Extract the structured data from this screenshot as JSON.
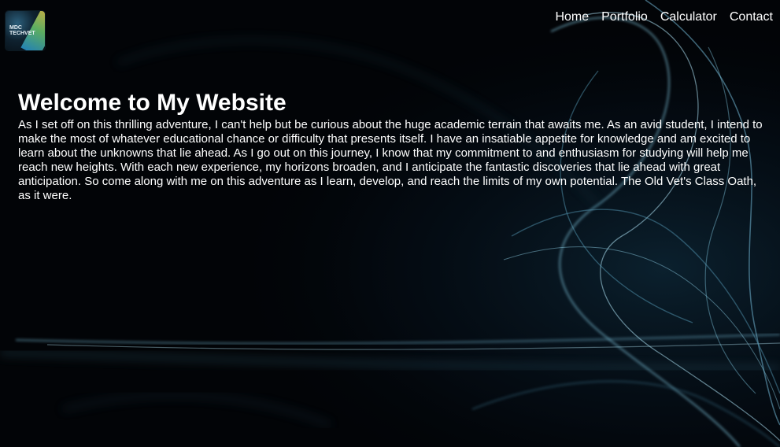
{
  "logo": {
    "line1": "MDC",
    "line2": "TECHVET"
  },
  "nav": {
    "items": [
      "Home",
      "Portfolio",
      "Calculator",
      "Contact"
    ]
  },
  "main": {
    "title": "Welcome to My Website",
    "body": "As I set off on this thrilling adventure, I can't help but be curious about the huge academic terrain that awaits me. As an avid student, I intend to make the most of whatever educational chance or difficulty that presents itself. I have an insatiable appetite for knowledge and am excited to learn about the unknowns that lie ahead. As I go out on this journey, I know that my commitment to and enthusiasm for studying will help me reach new heights. With each new experience, my horizons broaden, and I anticipate the fantastic discoveries that lie ahead with great anticipation. So come along with me on this adventure as I learn, develop, and reach the limits of my own potential. The Old Vet's Class Oath, as it were."
  },
  "colors": {
    "background": "#020407",
    "text": "#ffffff",
    "accent": "#6fb3cf"
  }
}
